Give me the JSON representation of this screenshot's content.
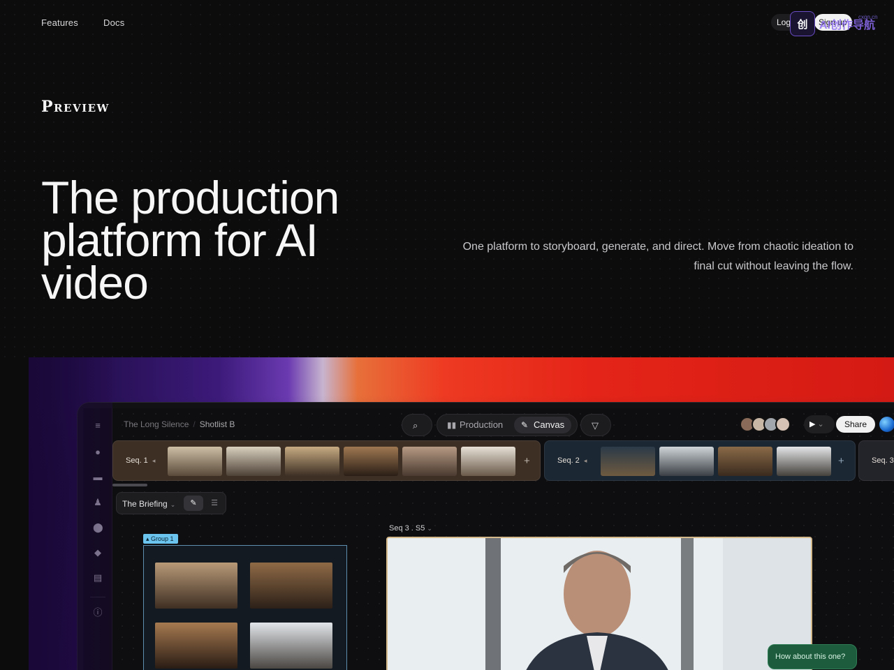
{
  "nav": {
    "features": "Features",
    "docs": "Docs",
    "login": "Log in",
    "signup": "Sign up"
  },
  "watermark": {
    "badge": "创",
    "text": "AI创作导航",
    "sub": "cxgn.cn"
  },
  "brand": {
    "logo": "Preview"
  },
  "hero": {
    "title": "The production platform for AI video",
    "subtitle": "One platform to storyboard, generate, and direct. Move from chaotic ideation to final cut without leaving the flow."
  },
  "app": {
    "breadcrumb": {
      "project": "The Long Silence",
      "current": "Shotlist B"
    },
    "views": {
      "production": "Production",
      "canvas": "Canvas"
    },
    "share": "Share",
    "sequences": [
      {
        "label": "Seq. 1"
      },
      {
        "label": "Seq. 2"
      },
      {
        "label": "Seq. 3"
      }
    ],
    "board": {
      "name": "The Briefing"
    },
    "shot_label": "Seq 3 . S5",
    "group_label": "Group 1",
    "chat_message": "How about this one?"
  },
  "colors": {
    "accent_red": "#e42418",
    "accent_purple": "#6a3ab0",
    "group_blue": "#6bc4ee",
    "chat_green": "#1e5c3e"
  }
}
